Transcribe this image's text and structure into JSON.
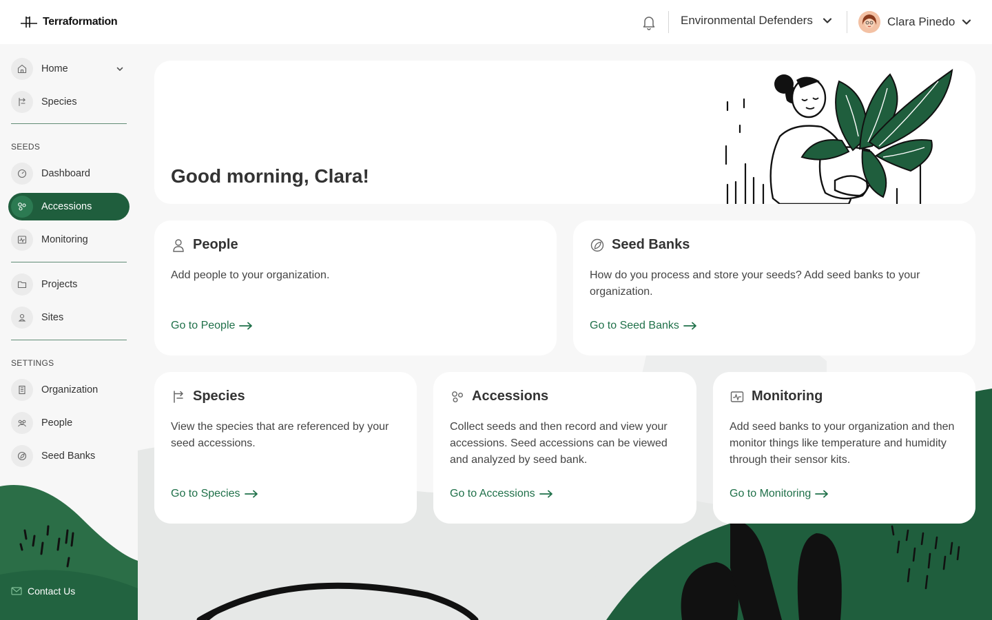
{
  "brand": {
    "name": "Terraformation"
  },
  "header": {
    "org": "Environmental Defenders",
    "user": "Clara Pinedo",
    "icons": {
      "bell": "bell-icon",
      "chevron": "chevron-down-icon"
    }
  },
  "sidebar": {
    "items": [
      {
        "label": "Home",
        "icon": "home-icon"
      },
      {
        "label": "Species",
        "icon": "species-icon"
      }
    ],
    "seeds_header": "SEEDS",
    "seeds": [
      {
        "label": "Dashboard",
        "icon": "gauge-icon"
      },
      {
        "label": "Accessions",
        "icon": "seeds-icon"
      },
      {
        "label": "Monitoring",
        "icon": "monitor-icon"
      }
    ],
    "more": [
      {
        "label": "Projects",
        "icon": "folder-icon"
      },
      {
        "label": "Sites",
        "icon": "location-icon"
      }
    ],
    "settings_header": "SETTINGS",
    "settings": [
      {
        "label": "Organization",
        "icon": "building-icon"
      },
      {
        "label": "People",
        "icon": "people-icon"
      },
      {
        "label": "Seed Banks",
        "icon": "seed-bank-icon"
      }
    ],
    "contact": "Contact Us"
  },
  "main": {
    "greeting": "Good morning, Clara!",
    "cards": [
      {
        "title": "People",
        "desc": "Add people to your organization.",
        "link": "Go to People"
      },
      {
        "title": "Seed Banks",
        "desc": "How do you process and store your seeds? Add seed banks to your organization.",
        "link": "Go to Seed Banks"
      },
      {
        "title": "Species",
        "desc": "View the species that are referenced by your seed accessions.",
        "link": "Go to Species"
      },
      {
        "title": "Accessions",
        "desc": "Collect seeds and then record and view your accessions. Seed accessions can be viewed and analyzed by seed bank.",
        "link": "Go to Accessions"
      },
      {
        "title": "Monitoring",
        "desc": "Add seed banks to your organization and then monitor things like temperature and humidity through their sensor kits.",
        "link": "Go to Monitoring"
      }
    ]
  },
  "colors": {
    "brand_green": "#1f5e3d",
    "link_green": "#1f7049",
    "bg": "#f7f7f7"
  }
}
